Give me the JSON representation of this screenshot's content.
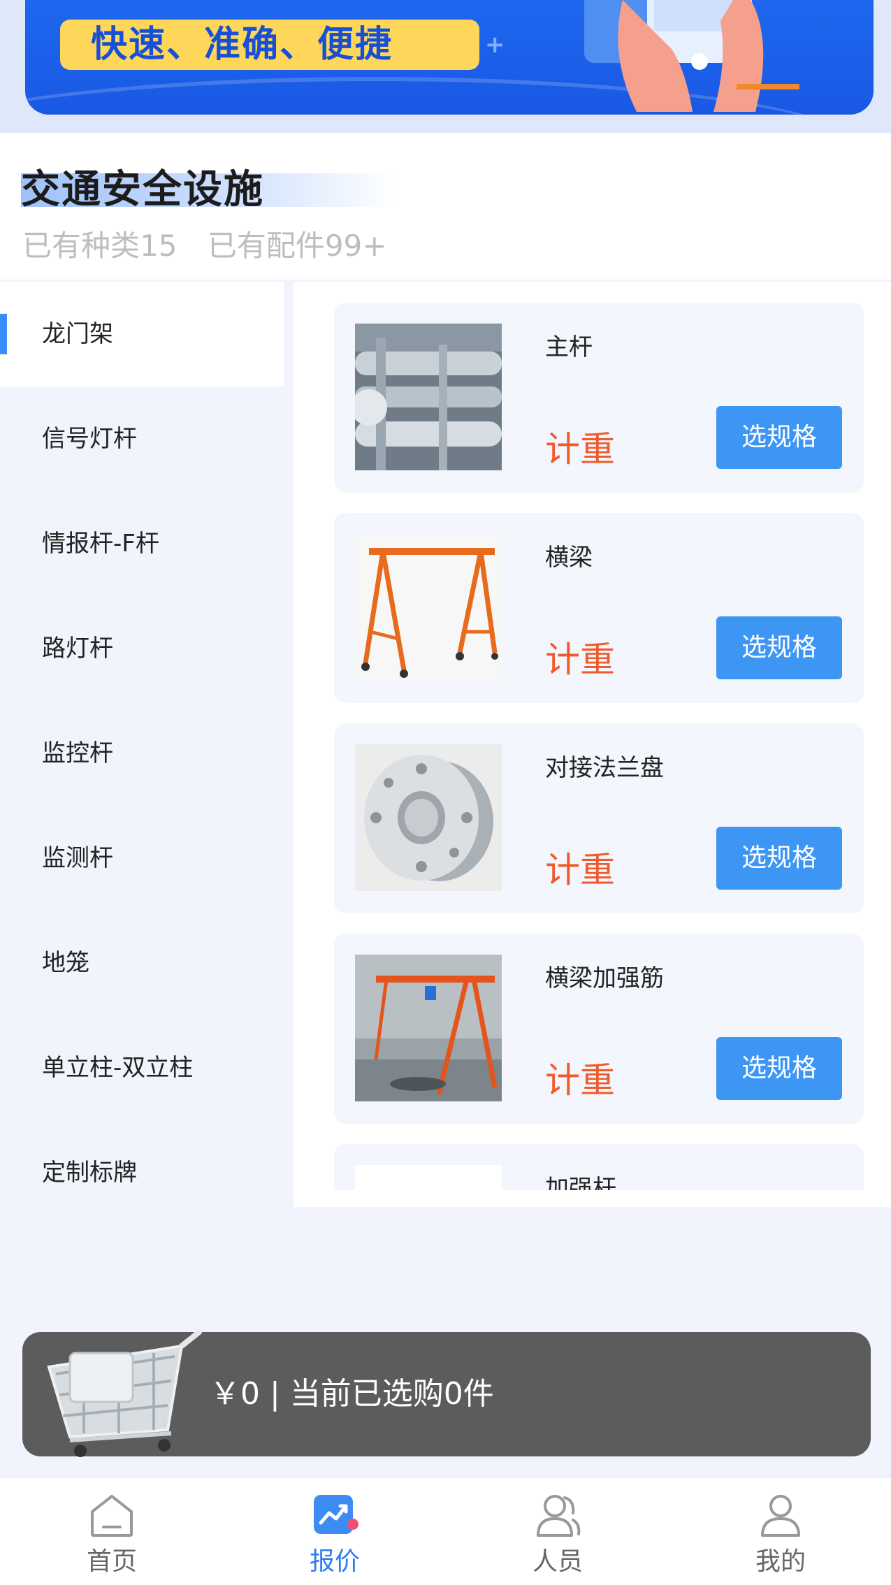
{
  "banner": {
    "slogan": "快速、准确、便捷"
  },
  "header": {
    "title": "交通安全设施",
    "stat_kinds": "已有种类15",
    "stat_parts": "已有配件99+"
  },
  "sidebar": {
    "items": [
      {
        "label": "龙门架",
        "active": true
      },
      {
        "label": "信号灯杆"
      },
      {
        "label": "情报杆-F杆"
      },
      {
        "label": "路灯杆"
      },
      {
        "label": "监控杆"
      },
      {
        "label": "监测杆"
      },
      {
        "label": "地笼"
      },
      {
        "label": "单立柱-双立柱"
      },
      {
        "label": "定制标牌"
      }
    ]
  },
  "products": [
    {
      "name": "主杆",
      "price": "计重",
      "button": "选规格",
      "image": "galvanized-pipes-photo"
    },
    {
      "name": "横梁",
      "price": "计重",
      "button": "选规格",
      "image": "orange-gantry-frame-photo"
    },
    {
      "name": "对接法兰盘",
      "price": "计重",
      "button": "选规格",
      "image": "steel-flange-photo"
    },
    {
      "name": "横梁加强筋",
      "price": "计重",
      "button": "选规格",
      "image": "gantry-crane-workshop-photo"
    },
    {
      "name": "加强杆",
      "price": "",
      "button": "",
      "image": "partially-visible"
    }
  ],
  "cart": {
    "summary": "￥0 | 当前已选购0件"
  },
  "tabbar": {
    "items": [
      {
        "label": "首页",
        "icon": "home-icon"
      },
      {
        "label": "报价",
        "icon": "quote-chart-icon",
        "active": true
      },
      {
        "label": "人员",
        "icon": "people-icon"
      },
      {
        "label": "我的",
        "icon": "profile-icon"
      }
    ]
  },
  "colors": {
    "accent": "#3d96f4",
    "price": "#ef5b2c",
    "banner": "#1a58e4",
    "cart_bar": "#5c5c5c"
  }
}
